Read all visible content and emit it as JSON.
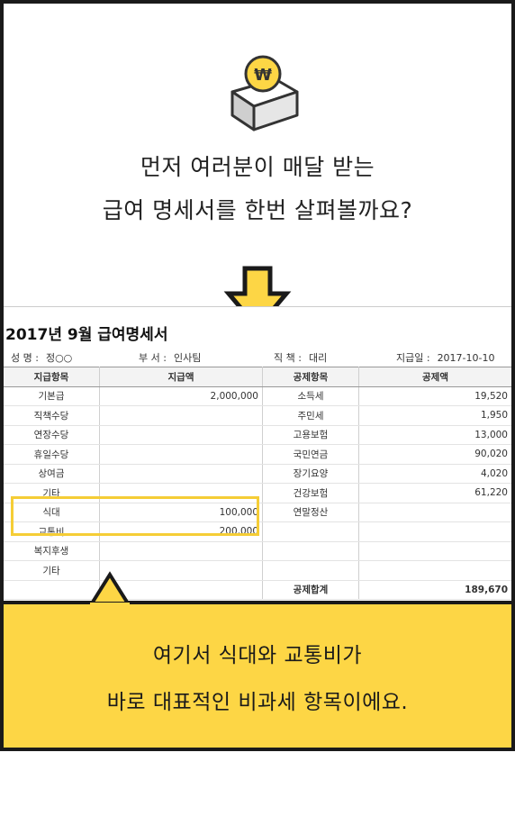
{
  "headline": {
    "line1": "먼저 여러분이 매달 받는",
    "line2": "급여 명세서를 한번 살펴볼까요?"
  },
  "coin_symbol": "₩",
  "document": {
    "title": "2017년 9월 급여명세서",
    "info": {
      "name_label": "성 명 :",
      "name_value": "정○○",
      "dept_label": "부 서 :",
      "dept_value": "인사팀",
      "position_label": "직 책 :",
      "position_value": "대리",
      "date_label": "지급일 :",
      "date_value": "2017-10-10"
    },
    "columns": [
      "지급항목",
      "지급액",
      "공제항목",
      "공제액"
    ],
    "rows": [
      [
        "기본급",
        "2,000,000",
        "소득세",
        "19,520"
      ],
      [
        "직책수당",
        "",
        "주민세",
        "1,950"
      ],
      [
        "연장수당",
        "",
        "고용보험",
        "13,000"
      ],
      [
        "휴일수당",
        "",
        "국민연금",
        "90,020"
      ],
      [
        "상여금",
        "",
        "장기요양",
        "4,020"
      ],
      [
        "기타",
        "",
        "건강보험",
        "61,220"
      ],
      [
        "식대",
        "100,000",
        "연말정산",
        ""
      ],
      [
        "교통비",
        "200,000",
        "",
        ""
      ],
      [
        "복지후생",
        "",
        "",
        ""
      ],
      [
        "기타",
        "",
        "",
        ""
      ],
      [
        "",
        "",
        "공제합계",
        "189,670"
      ]
    ]
  },
  "caption": {
    "line1": "여기서 식대와 교통비가",
    "line2": "바로 대표적인 비과세 항목이에요."
  },
  "colors": {
    "accent": "#fdd645",
    "highlight": "#f5cd36",
    "border": "#1a1a1a"
  }
}
